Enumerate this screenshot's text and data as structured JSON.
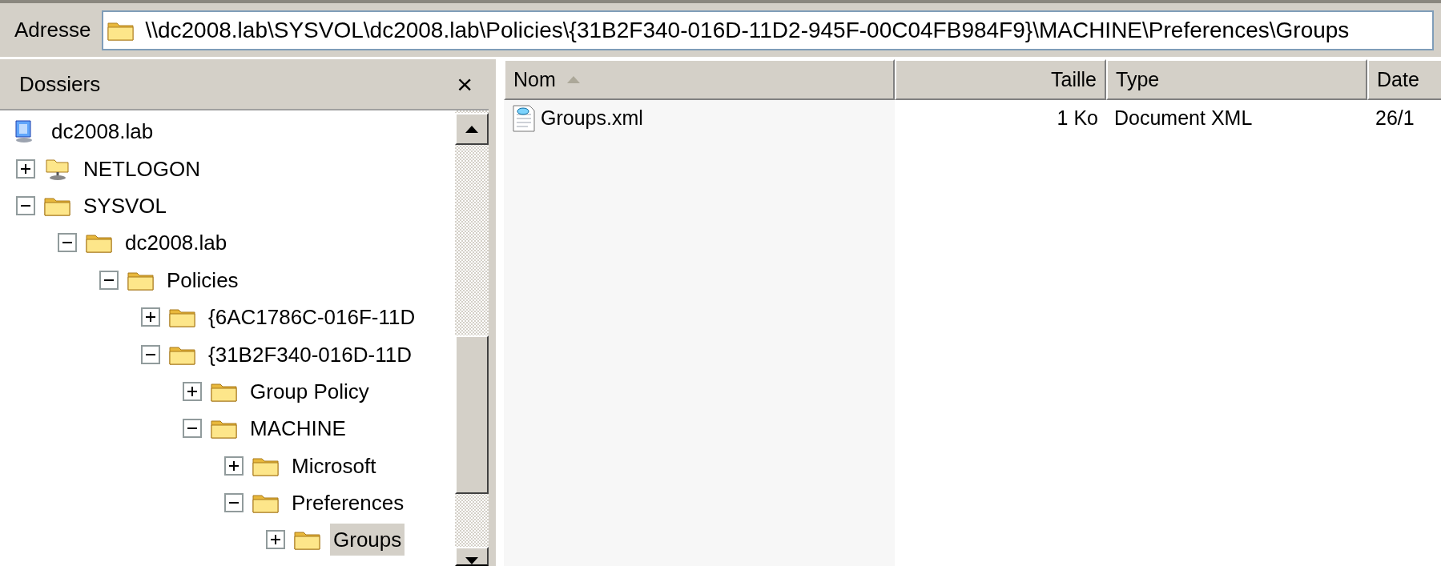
{
  "address_bar": {
    "label": "Adresse",
    "value": "\\\\dc2008.lab\\SYSVOL\\dc2008.lab\\Policies\\{31B2F340-016D-11D2-945F-00C04FB984F9}\\MACHINE\\Preferences\\Groups"
  },
  "folders_pane": {
    "title": "Dossiers",
    "close": "×",
    "tree": [
      {
        "label": "dc2008.lab",
        "kind": "computer",
        "selected": false,
        "children": [
          {
            "label": "NETLOGON",
            "kind": "share",
            "expanded": false,
            "selected": false
          },
          {
            "label": "SYSVOL",
            "kind": "folder",
            "expanded": true,
            "selected": false,
            "children": [
              {
                "label": "dc2008.lab",
                "kind": "folder",
                "expanded": true,
                "selected": false,
                "children": [
                  {
                    "label": "Policies",
                    "kind": "folder",
                    "expanded": true,
                    "selected": false,
                    "children": [
                      {
                        "label": "{6AC1786C-016F-11D",
                        "kind": "folder",
                        "expanded": false,
                        "selected": false
                      },
                      {
                        "label": "{31B2F340-016D-11D",
                        "kind": "folder",
                        "expanded": true,
                        "selected": false,
                        "children": [
                          {
                            "label": "Group Policy",
                            "kind": "folder",
                            "expanded": false,
                            "selected": false
                          },
                          {
                            "label": "MACHINE",
                            "kind": "folder",
                            "expanded": true,
                            "selected": false,
                            "children": [
                              {
                                "label": "Microsoft",
                                "kind": "folder",
                                "expanded": false,
                                "selected": false
                              },
                              {
                                "label": "Preferences",
                                "kind": "folder",
                                "expanded": true,
                                "selected": false,
                                "children": [
                                  {
                                    "label": "Groups",
                                    "kind": "folder",
                                    "expanded": false,
                                    "selected": true
                                  }
                                ]
                              }
                            ]
                          }
                        ]
                      }
                    ]
                  }
                ]
              }
            ]
          }
        ]
      }
    ]
  },
  "file_list": {
    "columns": [
      {
        "label": "Nom",
        "right_aligned": false,
        "sorted": true
      },
      {
        "label": "Taille",
        "right_aligned": true,
        "sorted": false
      },
      {
        "label": "Type",
        "right_aligned": false,
        "sorted": false
      },
      {
        "label": "Date",
        "right_aligned": false,
        "sorted": false
      }
    ],
    "rows": [
      {
        "kind": "xml",
        "cells": [
          "Groups.xml",
          "1 Ko",
          "Document XML",
          "26/1"
        ]
      }
    ]
  }
}
